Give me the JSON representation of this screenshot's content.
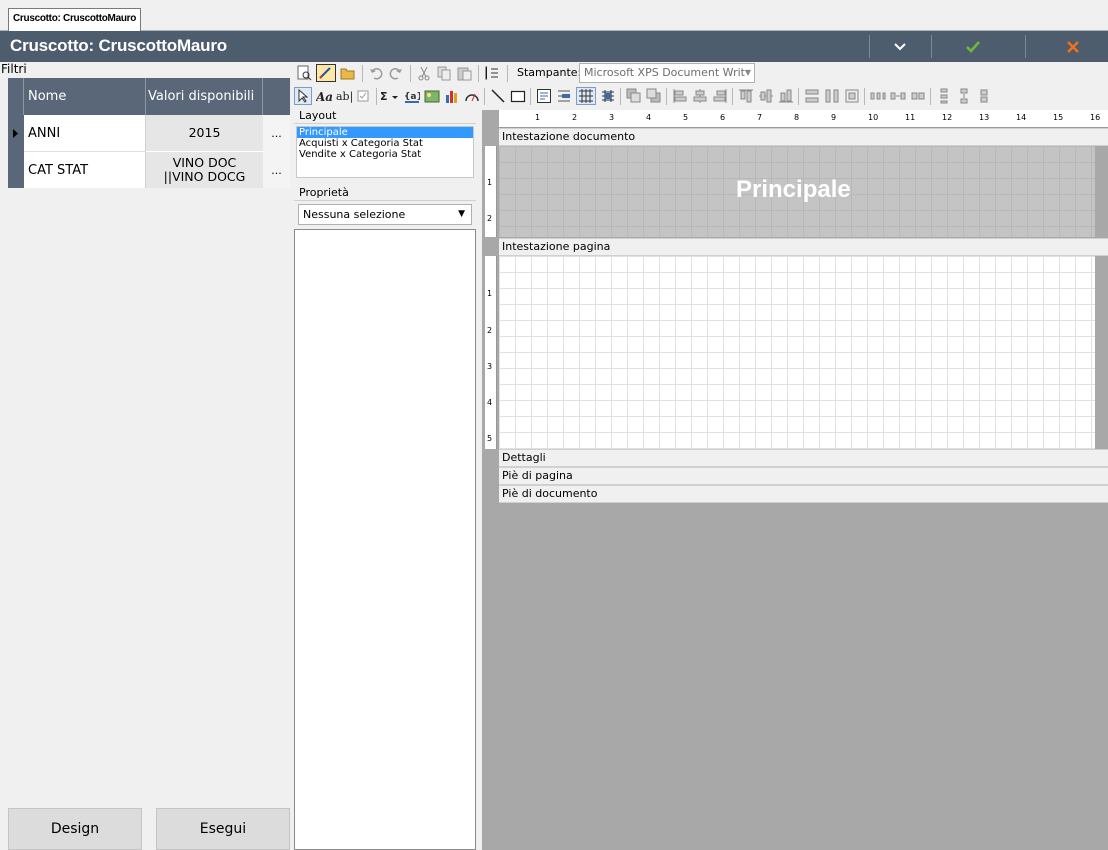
{
  "tab": {
    "label": "Cruscotto: CruscottoMauro"
  },
  "titlebar": {
    "title": "Cruscotto: CruscottoMauro"
  },
  "filters": {
    "label": "Filtri",
    "columns": [
      "Nome",
      "Valori disponibili"
    ],
    "rows": [
      {
        "name": "ANNI",
        "value": "2015",
        "dots": "..."
      },
      {
        "name": "CAT STAT",
        "value_line1": "VINO DOC",
        "value_line2": "||VINO DOCG",
        "dots": "..."
      }
    ]
  },
  "buttons": {
    "design": "Design",
    "run": "Esegui"
  },
  "toolbar": {
    "printer_label": "Stampante:",
    "printer_value": "Microsoft XPS Document Writ"
  },
  "layout_panel": {
    "header": "Layout",
    "items": [
      "Principale",
      "Acquisti x Categoria Stat",
      "Vendite x Categoria Stat"
    ],
    "selected_index": 0
  },
  "properties_panel": {
    "header": "Proprietà",
    "selection": "Nessuna selezione"
  },
  "report": {
    "ruler_ticks": [
      "1",
      "2",
      "3",
      "4",
      "5",
      "6",
      "7",
      "8",
      "9",
      "10",
      "11",
      "12",
      "13",
      "14",
      "15",
      "16"
    ],
    "bands": {
      "doc_header": "Intestazione documento",
      "doc_header_title": "Principale",
      "page_header": "Intestazione pagina",
      "details": "Dettagli",
      "page_footer": "Piè di pagina",
      "doc_footer": "Piè di documento"
    },
    "vruler_doc": [
      "1",
      "2"
    ],
    "vruler_page": [
      "1",
      "2",
      "3",
      "4",
      "5"
    ]
  },
  "colors": {
    "titlebar": "#4e5d6e",
    "selection": "#3399ff",
    "accept": "#6dbb3c",
    "close": "#f0721e"
  }
}
